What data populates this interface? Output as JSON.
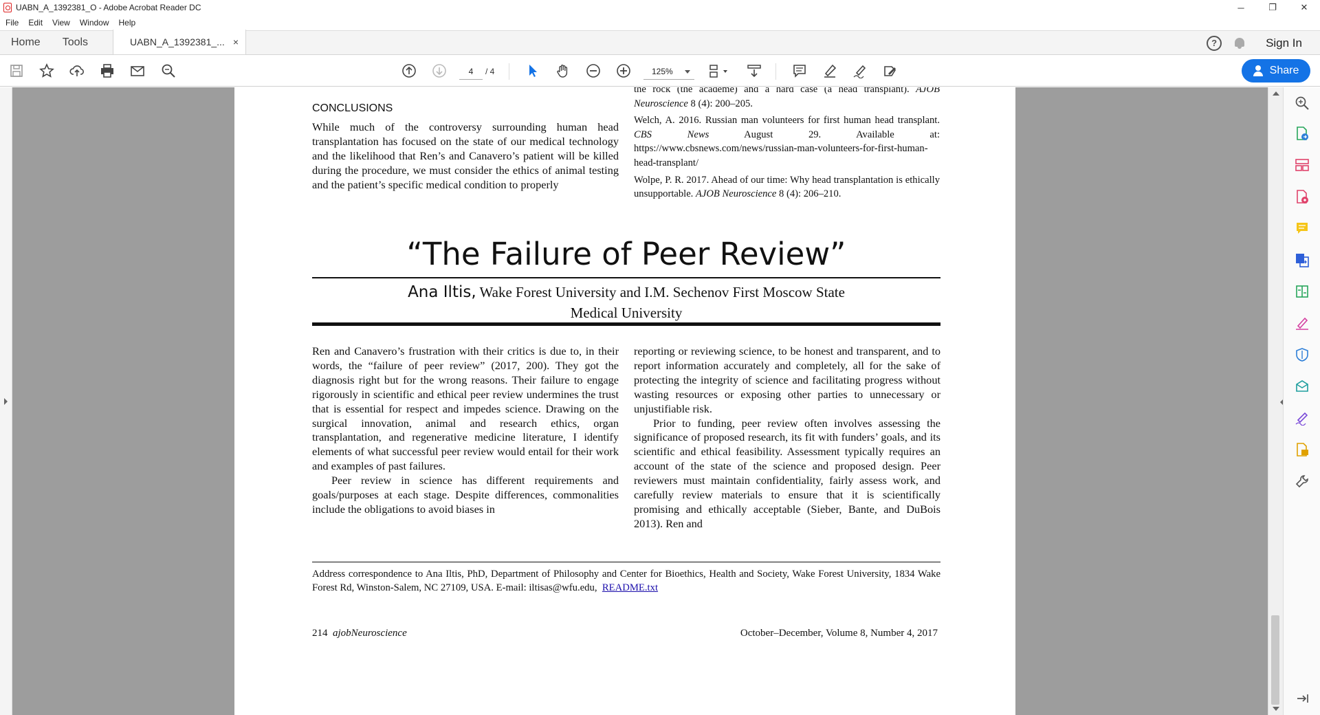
{
  "window": {
    "title": "UABN_A_1392381_O - Adobe Acrobat Reader DC",
    "controls": {
      "minimize": "─",
      "maximize": "❐",
      "close": "✕"
    }
  },
  "menu": [
    "File",
    "Edit",
    "View",
    "Window",
    "Help"
  ],
  "tabs": {
    "home": "Home",
    "tools": "Tools",
    "document": "UABN_A_1392381_...",
    "close": "×"
  },
  "header_right": {
    "help": "?",
    "sign_in": "Sign In"
  },
  "toolbar": {
    "page_current": "4",
    "page_total": "/ 4",
    "zoom": "125%",
    "share_label": "Share",
    "accent_color": "#1473e6"
  },
  "document": {
    "top_left": {
      "heading": "CONCLUSIONS",
      "text": "While much of the controversy surrounding human head transplantation has focused on the state of our medical technology and the likelihood that Ren’s and Canavero’s patient will be killed during the procedure, we must consider the ethics of animal testing and the patient’s specific medical condition to properly"
    },
    "references": [
      {
        "pre": "the rock (the academe) and a hard case (a head transplant). ",
        "journal": "AJOB Neuroscience",
        "post": " 8 (4): 200–205."
      },
      {
        "pre": "Welch, A. 2016. Russian man volunteers for first human head transplant. ",
        "journal": "CBS News",
        "post": " August 29. Available at: https://www.cbsnews.com/news/russian-man-volunteers-for-first-human-head-transplant/"
      },
      {
        "pre": "Wolpe, P. R. 2017. Ahead of our time: Why head transplantation is ethically unsupportable. ",
        "journal": "AJOB Neuroscience",
        "post": " 8 (4): 206–210."
      }
    ],
    "title": "“The Failure of Peer Review”",
    "author": "Ana Iltis,",
    "affiliation_line1": "Wake Forest University and I.M. Sechenov First Moscow State",
    "affiliation_line2": "Medical University",
    "body_left_p1": "Ren and Canavero’s frustration with their critics is due to, in their words, the “failure of peer review” (2017, 200). They got the diagnosis right but for the wrong reasons. Their failure to engage rigorously in scientific and ethical peer review undermines the trust that is essential for respect and impedes science. Drawing on the surgical innovation, animal and research ethics, organ transplantation, and regenerative medicine literature, I identify elements of what successful peer review would entail for their work and examples of past failures.",
    "body_left_p2": "Peer review in science has different requirements and goals/purposes at each stage. Despite differences, commonalities include the obligations to avoid biases in",
    "body_right_p1": "reporting or reviewing science, to be honest and transparent, and to report information accurately and completely, all for the sake of protecting the integrity of science and facilitating progress without wasting resources or exposing other parties to unnecessary or unjustifiable risk.",
    "body_right_p2": "Prior to funding, peer review often involves assessing the significance of proposed research, its fit with funders’ goals, and its scientific and ethical feasibility. Assessment typically requires an account of the state of the science and proposed design. Peer reviewers must maintain confidentiality, fairly assess work, and carefully review materials to ensure that it is scientifically promising and ethically acceptable (Sieber, Bante, and DuBois 2013). Ren and",
    "footnote_text": "Address correspondence to Ana Iltis, PhD, Department of Philosophy and Center for Bioethics, Health and Society, Wake Forest University, 1834 Wake Forest Rd, Winston-Salem, NC 27109, USA. E-mail: iltisas@wfu.edu,",
    "footnote_link": "README.txt",
    "footer_page": "214",
    "footer_journal_a": "ajob",
    "footer_journal_b": "Neuroscience",
    "footer_issue": "October–December, Volume 8, Number 4, 2017"
  }
}
